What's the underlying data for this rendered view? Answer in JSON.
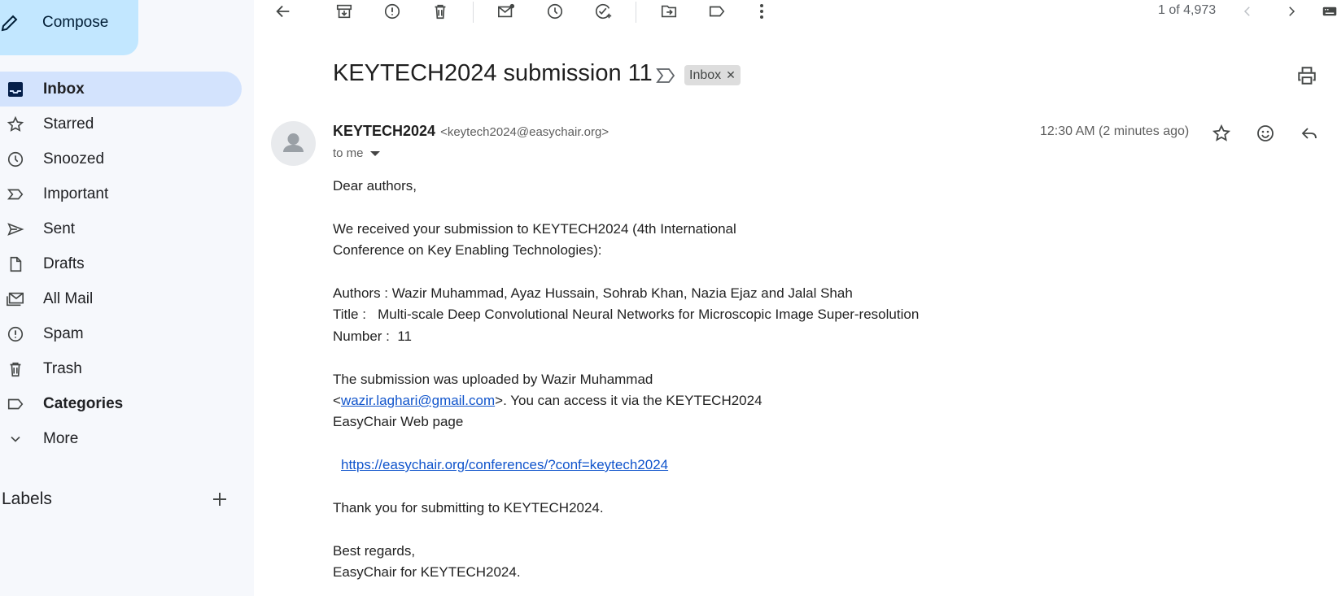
{
  "compose": {
    "label": "Compose"
  },
  "nav": [
    {
      "label": "Inbox",
      "icon": "inbox-icon"
    },
    {
      "label": "Starred",
      "icon": "star-icon"
    },
    {
      "label": "Snoozed",
      "icon": "clock-icon"
    },
    {
      "label": "Important",
      "icon": "important-icon"
    },
    {
      "label": "Sent",
      "icon": "send-icon"
    },
    {
      "label": "Drafts",
      "icon": "draft-icon"
    },
    {
      "label": "All Mail",
      "icon": "all-mail-icon"
    },
    {
      "label": "Spam",
      "icon": "spam-icon"
    },
    {
      "label": "Trash",
      "icon": "trash-icon"
    },
    {
      "label": "Categories",
      "icon": "label-icon"
    },
    {
      "label": "More",
      "icon": "chevron-down-icon"
    }
  ],
  "labels": {
    "title": "Labels"
  },
  "toolbar": {
    "pager": "1 of 4,973"
  },
  "message": {
    "subject": "KEYTECH2024 submission 11",
    "chip": "Inbox",
    "sender_name": "KEYTECH2024",
    "sender_email": "<keytech2024@easychair.org>",
    "recipient": "to me",
    "time": "12:30 AM (2 minutes ago)",
    "body": {
      "greeting": "Dear authors,",
      "p1_l1": "We received your submission to KEYTECH2024 (4th International",
      "p1_l2": "Conference on Key Enabling Technologies):",
      "authors": "Authors : Wazir Muhammad, Ayaz Hussain, Sohrab Khan, Nazia Ejaz and Jalal Shah",
      "title": "Title :   Multi-scale Deep Convolutional Neural Networks for Microscopic Image Super-resolution",
      "number": "Number :  11",
      "p2_l1": "The submission was uploaded by Wazir Muhammad",
      "p2_l2_pre": "<",
      "p2_l2_link": "wazir.laghari@gmail.com",
      "p2_l2_post": ">. You can access it via the KEYTECH2024",
      "p2_l3": "EasyChair Web page",
      "url": "https://easychair.org/conferences/?conf=keytech2024",
      "thanks": "Thank you for submitting to KEYTECH2024.",
      "regards": "Best regards,",
      "signature": "EasyChair for KEYTECH2024."
    }
  }
}
